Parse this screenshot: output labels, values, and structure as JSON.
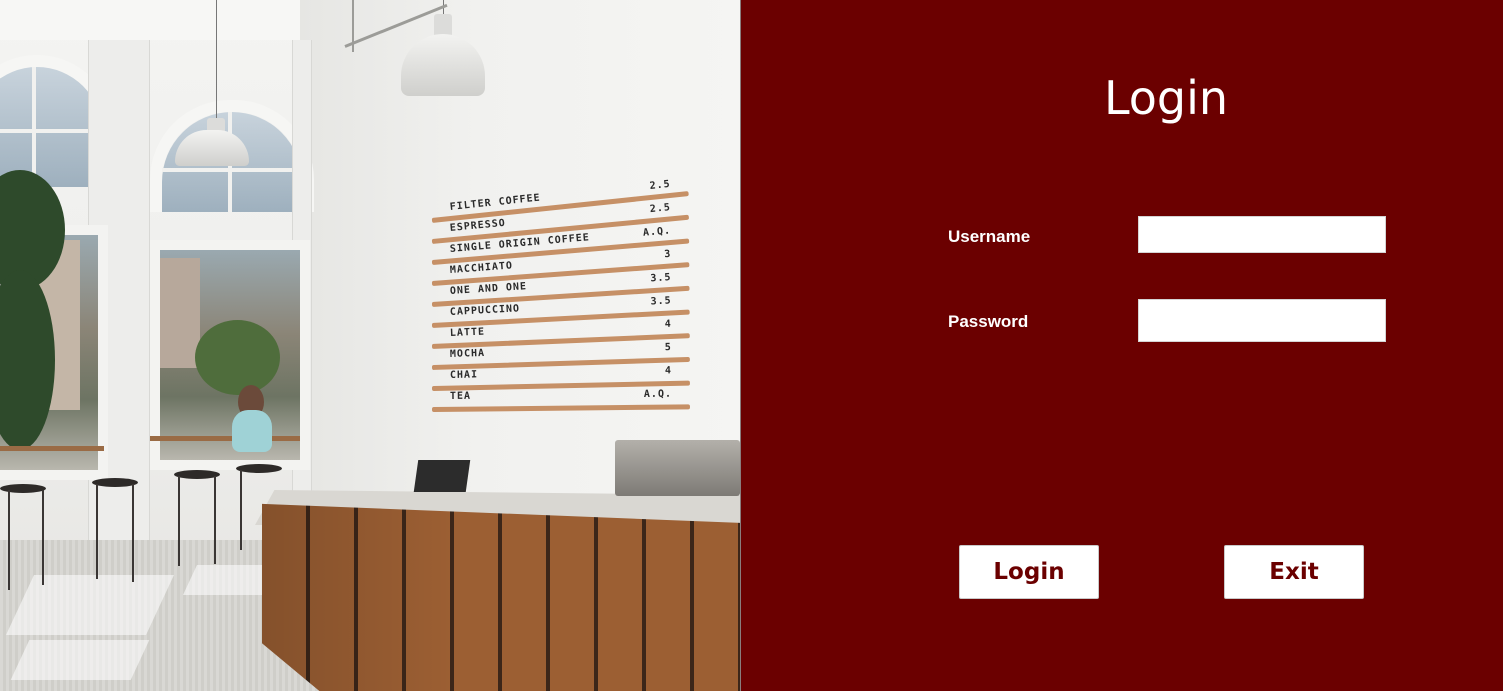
{
  "app": {
    "accent_color": "#6b0000",
    "panel_text_color": "#ffffff"
  },
  "login": {
    "title": "Login",
    "username": {
      "label": "Username",
      "value": "",
      "placeholder": ""
    },
    "password": {
      "label": "Password",
      "value": "",
      "placeholder": ""
    },
    "login_button": "Login",
    "exit_button": "Exit"
  },
  "cafe_menu_board": [
    {
      "item": "FILTER COFFEE",
      "price": "2.5"
    },
    {
      "item": "ESPRESSO",
      "price": "2.5"
    },
    {
      "item": "SINGLE ORIGIN COFFEE",
      "price": "A.Q."
    },
    {
      "item": "MACCHIATO",
      "price": "3"
    },
    {
      "item": "ONE AND ONE",
      "price": "3.5"
    },
    {
      "item": "CAPPUCCINO",
      "price": "3.5"
    },
    {
      "item": "LATTE",
      "price": "4"
    },
    {
      "item": "MOCHA",
      "price": "5"
    },
    {
      "item": "CHAI",
      "price": "4"
    },
    {
      "item": "TEA",
      "price": "A.Q."
    }
  ]
}
